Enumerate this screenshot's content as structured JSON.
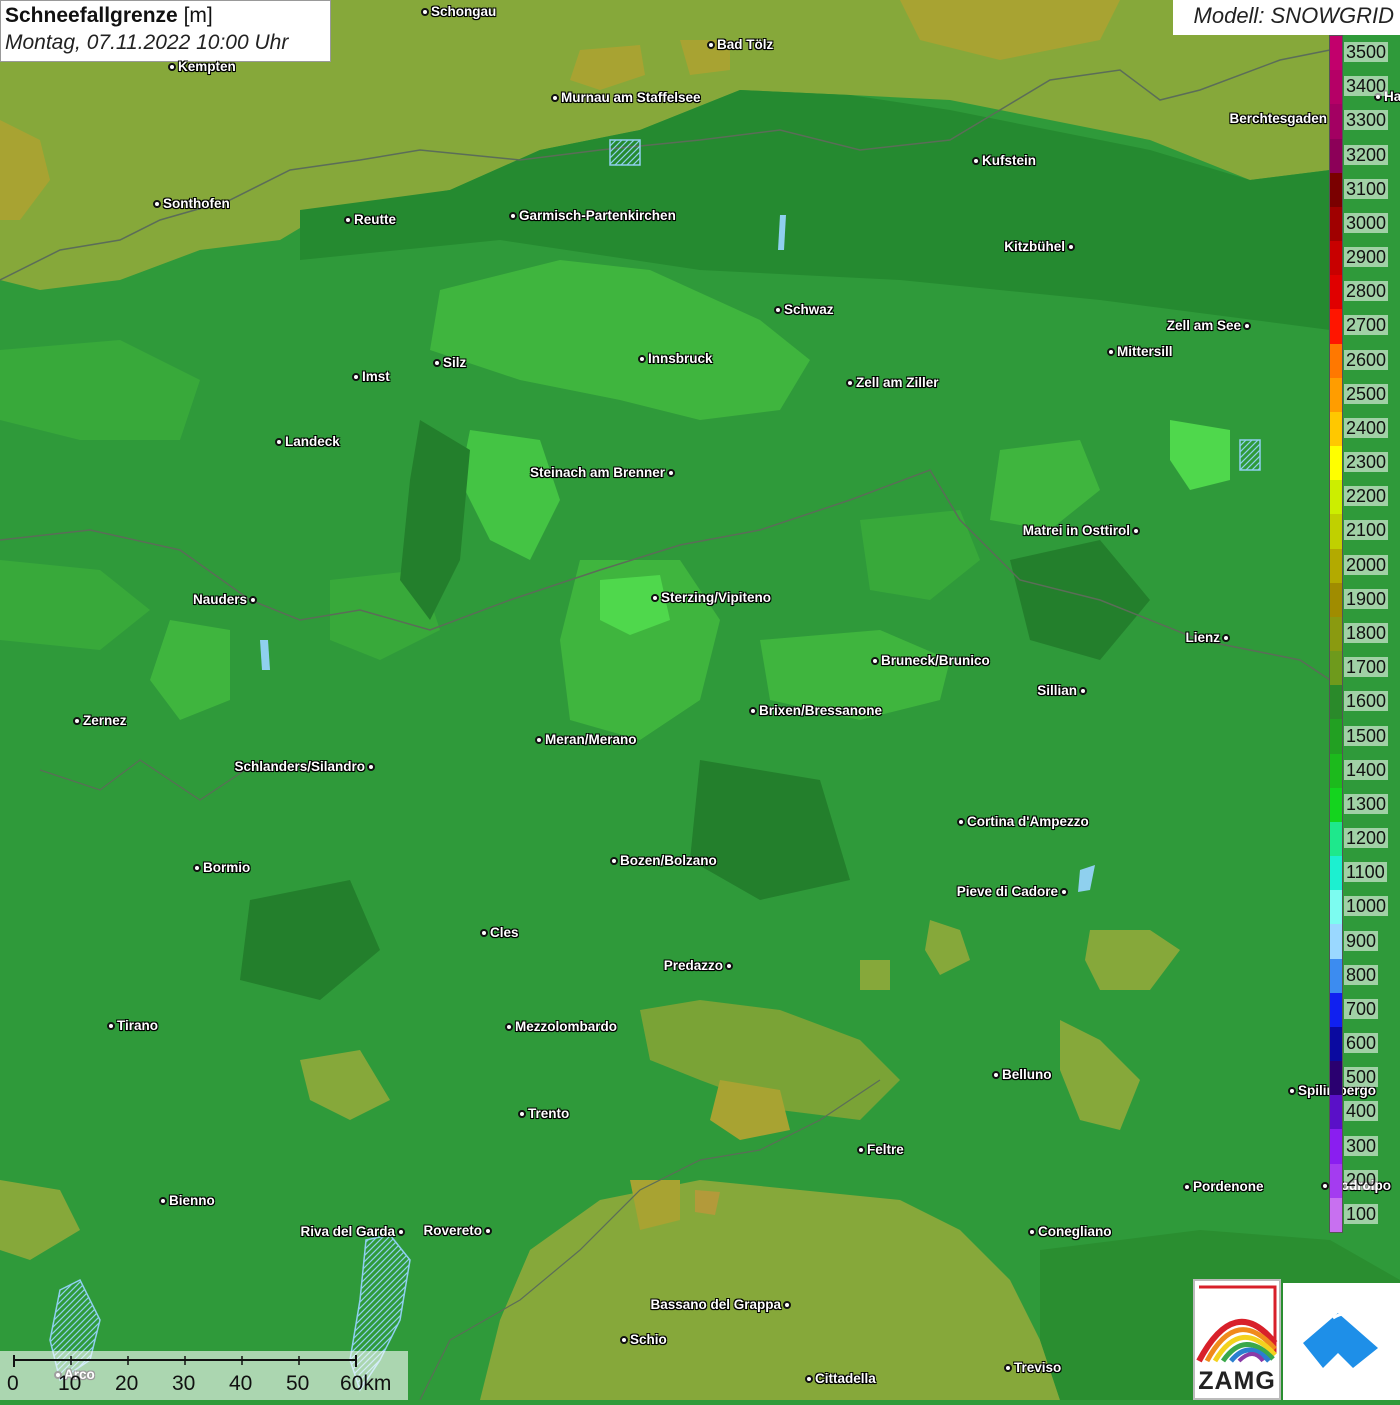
{
  "title": {
    "parameter": "Schneefallgrenze",
    "unit": "[m]",
    "datetime": "Montag, 07.11.2022 10:00 Uhr"
  },
  "model_label": "Modell: SNOWGRID",
  "legend": {
    "values": [
      3500,
      3400,
      3300,
      3200,
      3100,
      3000,
      2900,
      2800,
      2700,
      2600,
      2500,
      2400,
      2300,
      2200,
      2100,
      2000,
      1900,
      1800,
      1700,
      1600,
      1500,
      1400,
      1300,
      1200,
      1100,
      1000,
      900,
      800,
      700,
      600,
      500,
      400,
      300,
      200,
      100
    ],
    "colors": [
      "#c2006c",
      "#b50066",
      "#a30062",
      "#8c0058",
      "#7a0000",
      "#a00000",
      "#c80000",
      "#e00000",
      "#ff1500",
      "#ff7800",
      "#ff9d00",
      "#ffc800",
      "#ffff00",
      "#ccee00",
      "#c0d000",
      "#b3aa00",
      "#a08c00",
      "#8a9a10",
      "#6e9a1c",
      "#2a8a2a",
      "#22a022",
      "#1cba1c",
      "#14d41e",
      "#1ee88c",
      "#1cf0d0",
      "#7cfcf0",
      "#9ad8ff",
      "#3c8cf0",
      "#1020f0",
      "#0a0aa0",
      "#2a0070",
      "#5a10c8",
      "#8a1ef0",
      "#a43cf0",
      "#c870f0"
    ]
  },
  "cities": [
    {
      "name": "Schongau"
    },
    {
      "name": "Bad Tölz"
    },
    {
      "name": "Kempten"
    },
    {
      "name": "Murnau am Staffelsee"
    },
    {
      "name": "Berchtesgaden"
    },
    {
      "name": "Hallein"
    },
    {
      "name": "Kufstein"
    },
    {
      "name": "Sonthofen"
    },
    {
      "name": "Reutte"
    },
    {
      "name": "Garmisch-Partenkirchen"
    },
    {
      "name": "Kitzbühel"
    },
    {
      "name": "Schwaz"
    },
    {
      "name": "Zell am See"
    },
    {
      "name": "Mittersill"
    },
    {
      "name": "Innsbruck"
    },
    {
      "name": "Imst"
    },
    {
      "name": "Silz"
    },
    {
      "name": "Zell am Ziller"
    },
    {
      "name": "Landeck"
    },
    {
      "name": "Steinach am Brenner"
    },
    {
      "name": "Matrei in Osttirol"
    },
    {
      "name": "Nauders"
    },
    {
      "name": "Sterzing/Vipiteno"
    },
    {
      "name": "Lienz"
    },
    {
      "name": "Bruneck/Brunico"
    },
    {
      "name": "Sillian"
    },
    {
      "name": "Zernez"
    },
    {
      "name": "Brixen/Bressanone"
    },
    {
      "name": "Meran/Merano"
    },
    {
      "name": "Schlanders/Silandro"
    },
    {
      "name": "Cortina d'Ampezzo"
    },
    {
      "name": "Bozen/Bolzano"
    },
    {
      "name": "Bormio"
    },
    {
      "name": "Pieve di Cadore"
    },
    {
      "name": "Cles"
    },
    {
      "name": "Predazzo"
    },
    {
      "name": "Tirano"
    },
    {
      "name": "Mezzolombardo"
    },
    {
      "name": "Belluno"
    },
    {
      "name": "Spilimbergo"
    },
    {
      "name": "Trento"
    },
    {
      "name": "Feltre"
    },
    {
      "name": "Pordenone"
    },
    {
      "name": "Codroipo"
    },
    {
      "name": "Bienno"
    },
    {
      "name": "Riva del Garda"
    },
    {
      "name": "Rovereto"
    },
    {
      "name": "Conegliano"
    },
    {
      "name": "Bassano del Grappa"
    },
    {
      "name": "Schio"
    },
    {
      "name": "Arco"
    },
    {
      "name": "Treviso"
    },
    {
      "name": "Cittadella"
    }
  ],
  "scalebar": {
    "ticks": [
      "0",
      "10",
      "20",
      "30",
      "40",
      "50",
      "60km"
    ]
  },
  "logos": {
    "zamg_text": "ZAMG"
  }
}
